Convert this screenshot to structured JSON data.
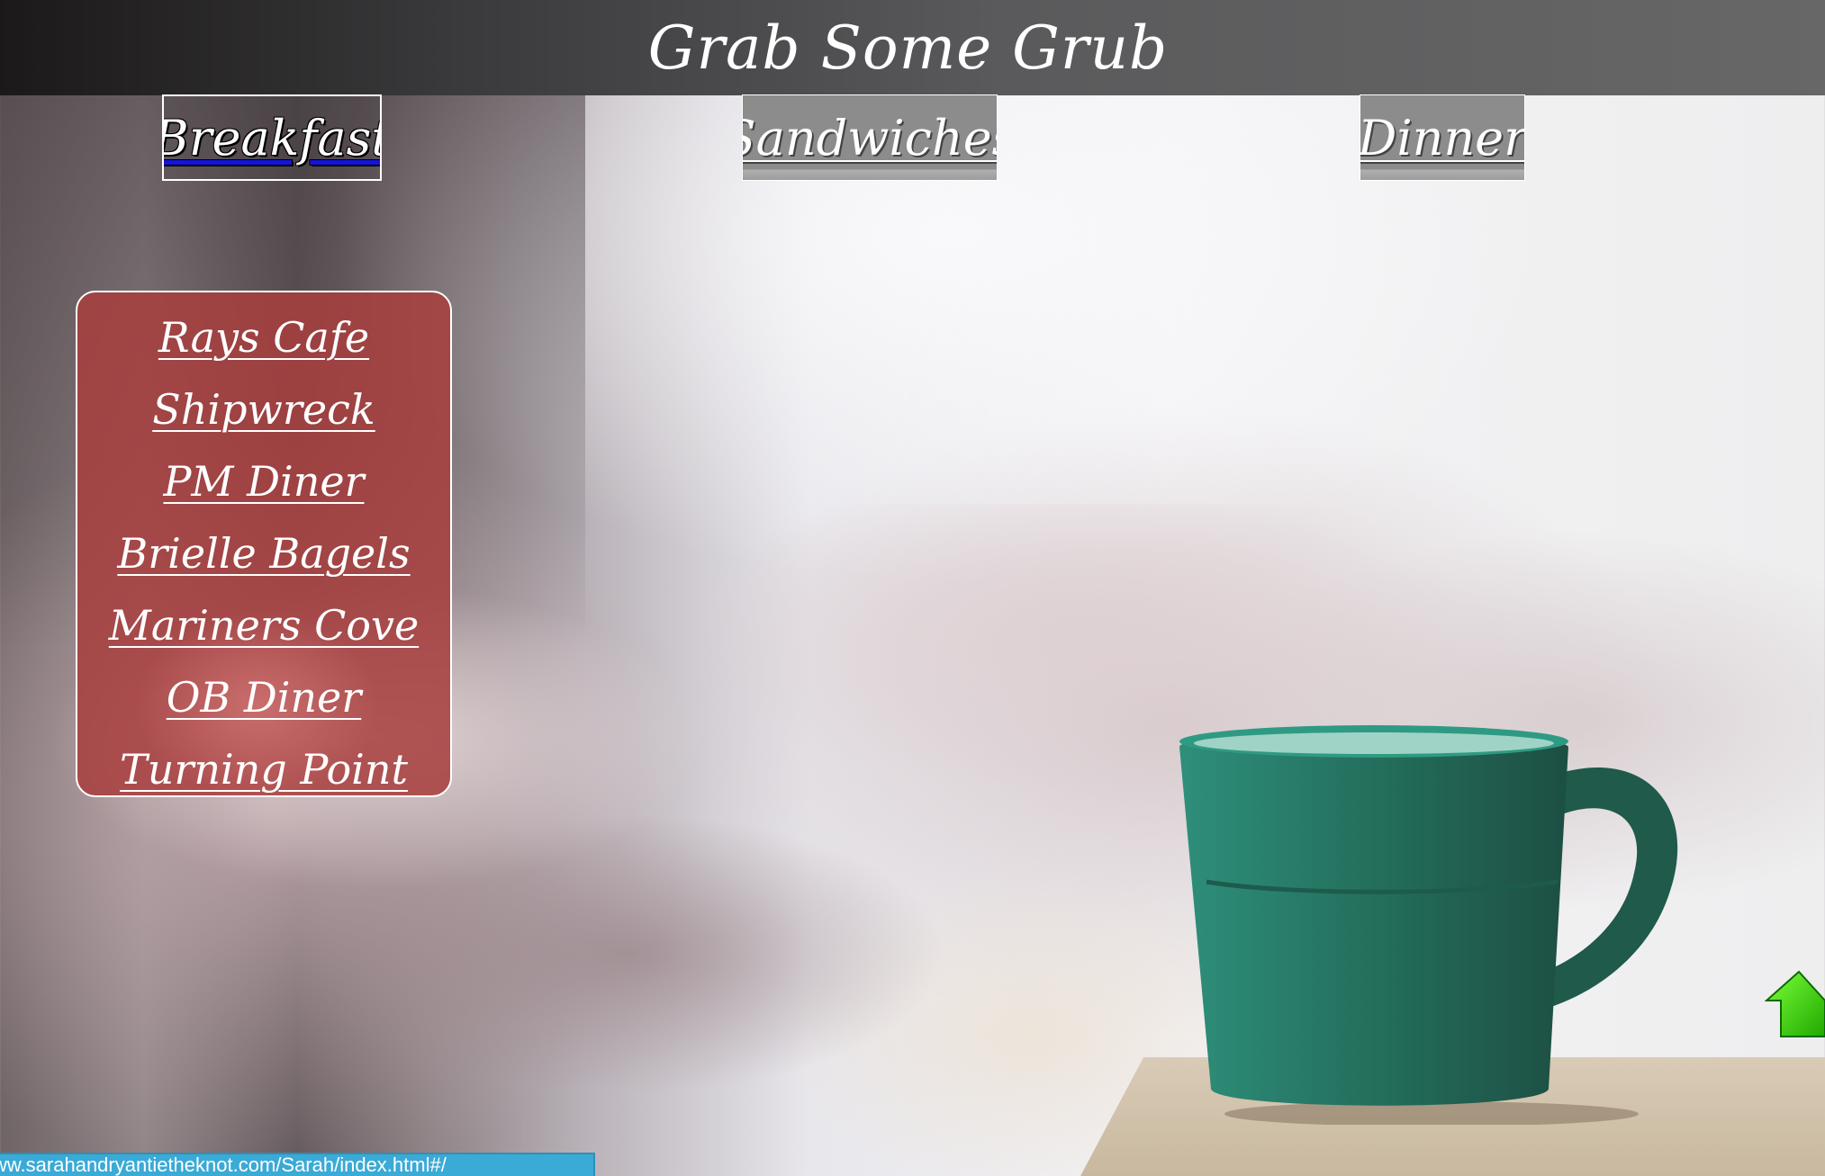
{
  "header": {
    "title": "Grab Some Grub"
  },
  "nav": {
    "tabs": [
      {
        "label": "Breakfast",
        "active": true
      },
      {
        "label": "Sandwiches",
        "active": false
      },
      {
        "label": "Dinner",
        "active": false
      }
    ]
  },
  "breakfast_panel": {
    "items": [
      "Rays Cafe",
      "Shipwreck",
      "PM Diner",
      "Brielle Bagels",
      "Mariners Cove",
      "OB Diner",
      "Turning Point"
    ]
  },
  "scroll_top": {
    "icon": "green-up-arrow-icon",
    "color": "#33cc00"
  },
  "status_bar": {
    "url": "ww.sarahandryantietheknot.com/Sarah/index.html#/"
  },
  "colors": {
    "header": "#5a5a5c",
    "panel": "#a83e3e",
    "active_underline": "#1414d8",
    "status_bar": "#3aaad6"
  }
}
